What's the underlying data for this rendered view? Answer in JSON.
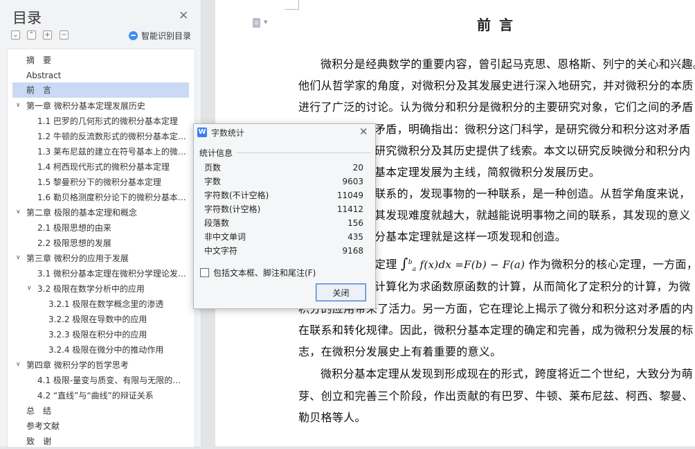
{
  "toc": {
    "title": "目录",
    "smart_label": "智能识别目录",
    "items": [
      {
        "label": "摘　要"
      },
      {
        "label": "Abstract"
      },
      {
        "label": "前　言"
      },
      {
        "label": "第一章  微积分基本定理发展历史"
      },
      {
        "label": "1.1 巴罗的几何形式的微积分基本定理"
      },
      {
        "label": "1.2 牛顿的反流数形式的微积分基本定…"
      },
      {
        "label": "1.3 莱布尼兹的建立在符号基本上的微…"
      },
      {
        "label": "1.4 柯西现代形式的微积分基本定理"
      },
      {
        "label": "1.5 黎曼积分下的微积分基本定理"
      },
      {
        "label": "1.6 勒贝格测度积分论下的微积分基本…"
      },
      {
        "label": "第二章  极限的基本定理和概念"
      },
      {
        "label": "2.1 极限思想的由来"
      },
      {
        "label": "2.2 极限思想的发展"
      },
      {
        "label": "第三章  微积分的应用于发展"
      },
      {
        "label": "3.1 微积分基本定理在微积分学理论发…"
      },
      {
        "label": "3.2 极限在数学分析中的应用"
      },
      {
        "label": "3.2.1  极限在数学概念里的渗透"
      },
      {
        "label": "3.2.2  极限在导数中的应用"
      },
      {
        "label": "3.2.3  极限在积分中的应用"
      },
      {
        "label": "3.2.4  极限在微分中的推动作用"
      },
      {
        "label": "第四章  微积分学的哲学思考"
      },
      {
        "label": "4.1 极限-量变与质变、有限与无限的…"
      },
      {
        "label": "4.2 “直线”与“曲线”的辩证关系"
      },
      {
        "label": "总　结"
      },
      {
        "label": "参考文献"
      },
      {
        "label": "致　谢"
      }
    ]
  },
  "document": {
    "title_a": "前",
    "title_b": "言",
    "lines": [
      "微积分是经典数学的重要内容，曾引起马克思、恩格斯、列宁的关心和兴趣。",
      "他们从哲学家的角度，对微积分及其发展史进行深入地研究，并对微积分的本质",
      "进行了广泛的讨论。认为微分和积分是微积分的主要研究对象，它们之间的矛盾",
      "矛盾，明确指出：微积分这门科学，是研究微分和积分这对矛盾",
      "研究微积分及其历史提供了线索。本文以研究反映微分和积分内",
      "基本定理发展为主线，简叙微积分发展历史。",
      "联系的，发现事物的一种联系，是一种创造。从哲学角度来说，",
      "其发现难度就越大，就越能说明事物之间的联系，其发现的意义",
      "分基本定理就是这样一项发现和创造。",
      "定理",
      "作为微积分的核心定理，一方面，它",
      "计算化为求函数原函数的计算，从而简化了定积分的计算，为微",
      "积分的应用带来了活力。另一方面，它在理论上揭示了微分和积分这对矛盾的内",
      "在联系和转化规律。因此，微积分基本定理的确定和完善，成为微积分发展的标",
      "志，在微积分发展史上有着重要的意义。",
      "微积分基本定理从发现到形成现在的形式，跨度将近二个世纪，大致分为萌",
      "芽、创立和完善三个阶段，作出贡献的有巴罗、牛顿、莱布尼兹、柯西、黎曼、",
      "勒贝格等人。"
    ],
    "formula": "f(x)dx =F(b) − F(a)",
    "integral_upper": "b",
    "integral_lower": "a"
  },
  "dialog": {
    "title": "字数统计",
    "section": "统计信息",
    "rows": [
      {
        "label": "页数",
        "value": "20"
      },
      {
        "label": "字数",
        "value": "9603"
      },
      {
        "label": "字符数(不计空格)",
        "value": "11049"
      },
      {
        "label": "字符数(计空格)",
        "value": "11412"
      },
      {
        "label": "段落数",
        "value": "156"
      },
      {
        "label": "非中文单词",
        "value": "435"
      },
      {
        "label": "中文字符",
        "value": "9168"
      }
    ],
    "checkbox_label": "包括文本框、脚注和尾注(F)",
    "checkbox_checked": false,
    "close_label": "关闭"
  }
}
